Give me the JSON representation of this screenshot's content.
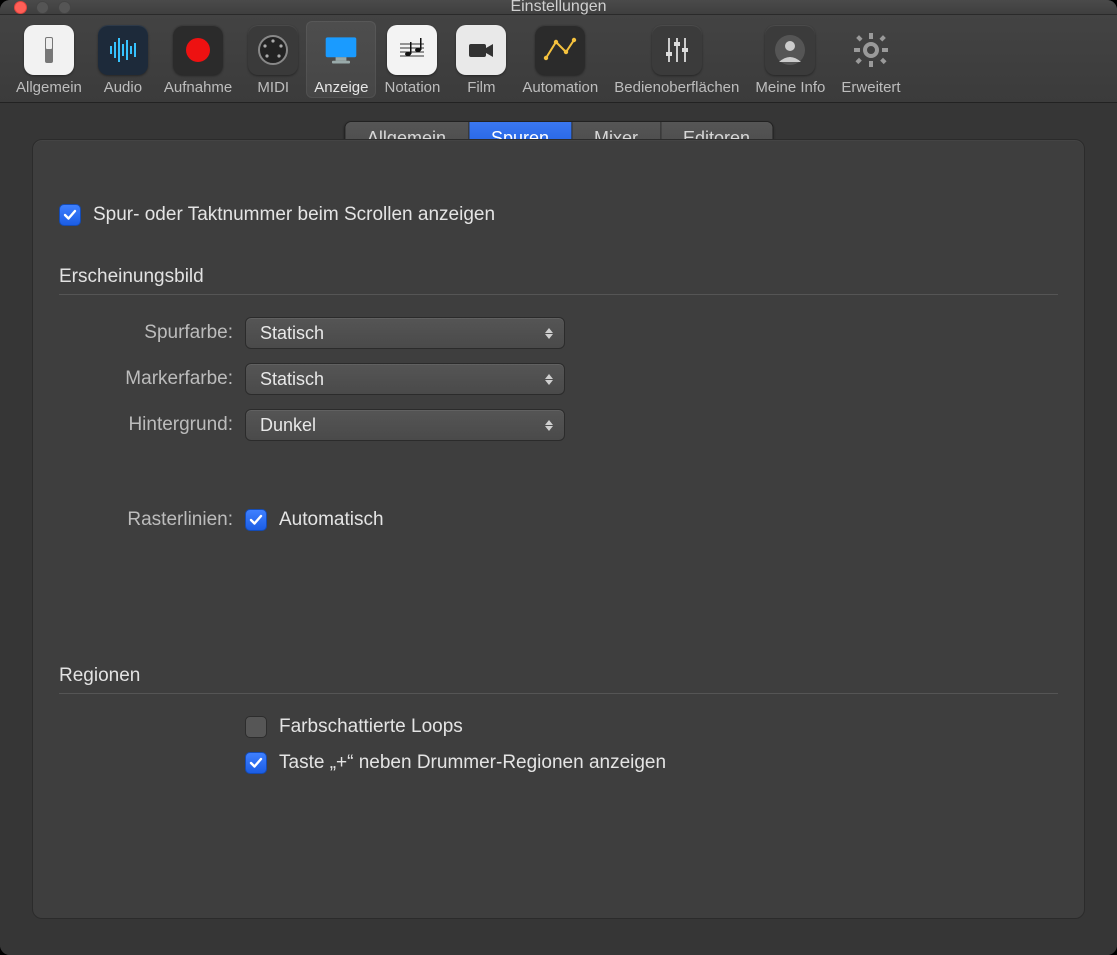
{
  "window": {
    "title": "Einstellungen"
  },
  "toolbar": {
    "items": [
      {
        "id": "general",
        "label": "Allgemein"
      },
      {
        "id": "audio",
        "label": "Audio"
      },
      {
        "id": "record",
        "label": "Aufnahme"
      },
      {
        "id": "midi",
        "label": "MIDI"
      },
      {
        "id": "display",
        "label": "Anzeige",
        "selected": true
      },
      {
        "id": "notation",
        "label": "Notation"
      },
      {
        "id": "film",
        "label": "Film"
      },
      {
        "id": "automation",
        "label": "Automation"
      },
      {
        "id": "surfaces",
        "label": "Bedienoberflächen"
      },
      {
        "id": "myinfo",
        "label": "Meine Info"
      },
      {
        "id": "advanced",
        "label": "Erweitert"
      }
    ]
  },
  "segTabs": {
    "items": [
      {
        "id": "allgemein",
        "label": "Allgemein"
      },
      {
        "id": "spuren",
        "label": "Spuren",
        "active": true
      },
      {
        "id": "mixer",
        "label": "Mixer"
      },
      {
        "id": "editoren",
        "label": "Editoren"
      }
    ]
  },
  "form": {
    "scrollCheckbox": {
      "label": "Spur- oder Taktnummer beim Scrollen anzeigen",
      "checked": true
    },
    "appearance": {
      "title": "Erscheinungsbild",
      "trackColor": {
        "label": "Spurfarbe:",
        "value": "Statisch"
      },
      "markerColor": {
        "label": "Markerfarbe:",
        "value": "Statisch"
      },
      "background": {
        "label": "Hintergrund:",
        "value": "Dunkel"
      },
      "gridLines": {
        "label": "Rasterlinien:",
        "value": "Automatisch",
        "checked": true
      }
    },
    "regions": {
      "title": "Regionen",
      "shadedLoops": {
        "label": "Farbschattierte Loops",
        "checked": false
      },
      "plusKey": {
        "label": "Taste „+“ neben Drummer-Regionen anzeigen",
        "checked": true
      }
    }
  }
}
